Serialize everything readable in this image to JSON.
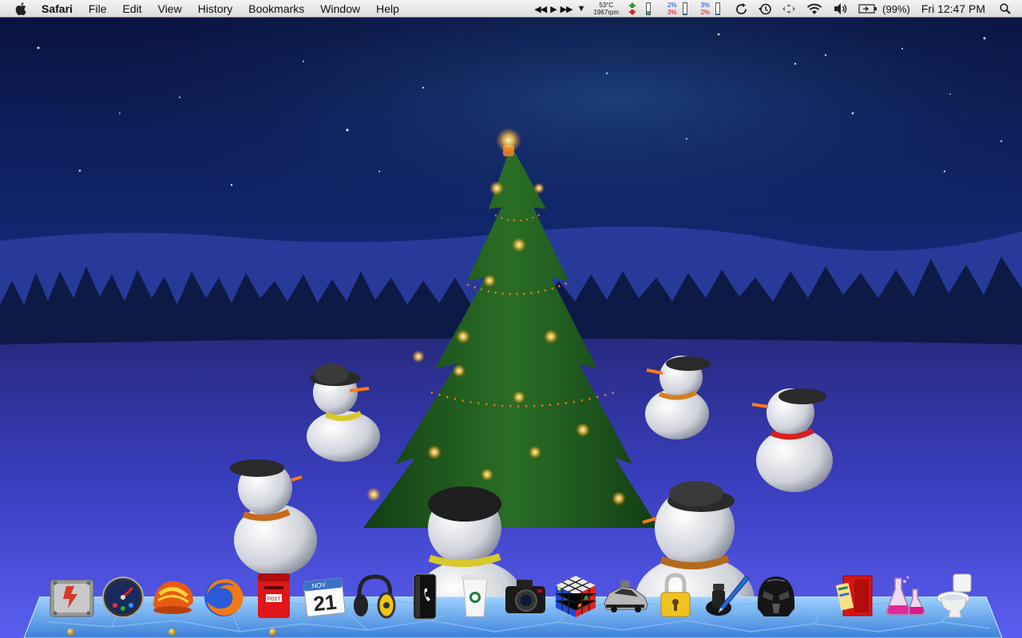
{
  "menubar": {
    "app_name": "Safari",
    "menus": [
      "File",
      "Edit",
      "View",
      "History",
      "Bookmarks",
      "Window",
      "Help"
    ],
    "status": {
      "temperature": "53°C",
      "fan_speed": "1967rpm",
      "cpu1_user": "2%",
      "cpu1_system": "3%",
      "cpu2_user": "3%",
      "cpu2_system": "2%",
      "battery_percent": "(99%)",
      "clock": "Fri 12:47 PM"
    }
  },
  "dock": {
    "calendar_month": "NOV",
    "calendar_day": "21",
    "mailbox_label": "POST",
    "items": [
      {
        "name": "Finder",
        "icon": "finder-icon",
        "running": true
      },
      {
        "name": "Dashboard",
        "icon": "dashboard-gauge-icon",
        "running": false
      },
      {
        "name": "Helmet",
        "icon": "red-helmet-icon",
        "running": true
      },
      {
        "name": "Firefox",
        "icon": "firefox-icon",
        "running": false
      },
      {
        "name": "Mail",
        "icon": "red-mailbox-icon",
        "running": true
      },
      {
        "name": "iCal",
        "icon": "calendar-icon",
        "running": false
      },
      {
        "name": "Headphones",
        "icon": "headphones-icon",
        "running": false
      },
      {
        "name": "Phone",
        "icon": "phone-icon",
        "running": false
      },
      {
        "name": "Coffee",
        "icon": "coffee-cup-icon",
        "running": false
      },
      {
        "name": "Camera",
        "icon": "camera-icon",
        "running": false
      },
      {
        "name": "Cube",
        "icon": "rubiks-cube-icon",
        "running": false
      },
      {
        "name": "Time Machine",
        "icon": "delorean-icon",
        "running": false
      },
      {
        "name": "Lock",
        "icon": "padlock-icon",
        "running": false
      },
      {
        "name": "Pen",
        "icon": "inkwell-pen-icon",
        "running": false
      },
      {
        "name": "Helmet2",
        "icon": "dark-helmet-icon",
        "running": false
      },
      {
        "name": "Documents",
        "icon": "documents-folder-icon",
        "running": false
      },
      {
        "name": "Flasks",
        "icon": "flasks-icon",
        "running": false
      },
      {
        "name": "Trash",
        "icon": "toilet-trash-icon",
        "running": false
      }
    ]
  },
  "colors": {
    "menubar": "#e8e8e8",
    "sky_top": "#0a1442",
    "snow_ground": "#3a3fc0",
    "tree": "#1f5a1e",
    "dock_ice": "#5aa0e8"
  }
}
